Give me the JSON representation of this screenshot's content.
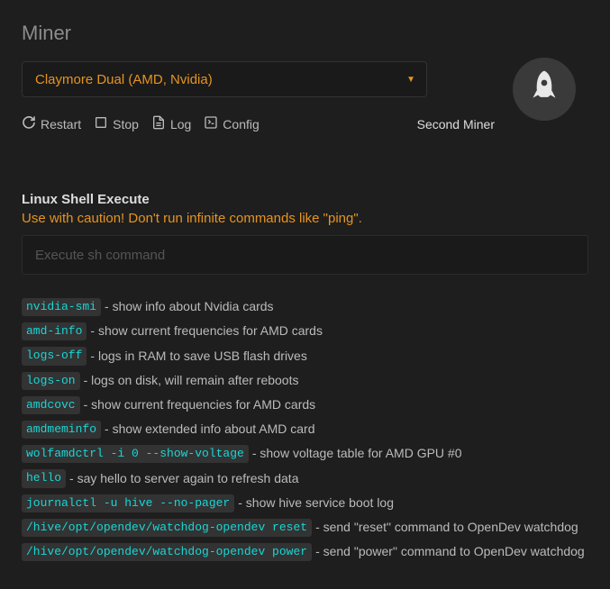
{
  "header": {
    "title": "Miner"
  },
  "miner_select": {
    "value": "Claymore Dual (AMD, Nvidia)"
  },
  "toolbar": {
    "restart": "Restart",
    "stop": "Stop",
    "log": "Log",
    "config": "Config",
    "second_miner": "Second Miner"
  },
  "shell": {
    "title": "Linux Shell Execute",
    "warning": "Use with caution! Don't run infinite commands like \"ping\".",
    "placeholder": "Execute sh command"
  },
  "commands": [
    {
      "cmd": "nvidia-smi",
      "desc": " - show info about Nvidia cards"
    },
    {
      "cmd": "amd-info",
      "desc": " - show current frequencies for AMD cards"
    },
    {
      "cmd": "logs-off",
      "desc": " - logs in RAM to save USB flash drives"
    },
    {
      "cmd": "logs-on",
      "desc": " - logs on disk, will remain after reboots"
    },
    {
      "cmd": "amdcovc",
      "desc": " - show current frequencies for AMD cards"
    },
    {
      "cmd": "amdmeminfo",
      "desc": " - show extended info about AMD card"
    },
    {
      "cmd": "wolfamdctrl -i 0 --show-voltage",
      "desc": " - show voltage table for AMD GPU #0"
    },
    {
      "cmd": "hello",
      "desc": " - say hello to server again to refresh data"
    },
    {
      "cmd": "journalctl -u hive --no-pager",
      "desc": " - show hive service boot log"
    },
    {
      "cmd": "/hive/opt/opendev/watchdog-opendev reset",
      "desc": " - send \"reset\" command to OpenDev watchdog"
    },
    {
      "cmd": "/hive/opt/opendev/watchdog-opendev power",
      "desc": " - send \"power\" command to OpenDev watchdog"
    }
  ]
}
